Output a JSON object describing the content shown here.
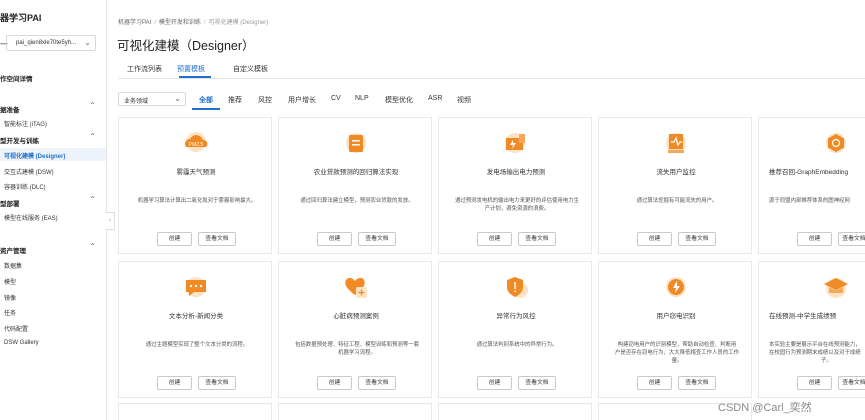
{
  "sidebar": {
    "title": "器学习PAI",
    "workspace_dash": "一",
    "workspace_value": "pai_qien8xle70te5yh...",
    "groups": [
      {
        "label": "作空间详情",
        "caret": ""
      },
      {
        "label": "据准备",
        "caret": "^"
      },
      {
        "label": "型开发与训练",
        "caret": "^"
      },
      {
        "label": "型部署",
        "caret": "^"
      },
      {
        "label": "资产管理",
        "caret": "^"
      }
    ],
    "items": {
      "itag": "智能标注 (iTAG)",
      "designer": "可视化建模 (Designer)",
      "dsw": "交互式建模 (DSW)",
      "dlc": "容器训练 (DLC)",
      "eas": "模型在线服务 (EAS)",
      "dataset": "数据集",
      "model": "模型",
      "image": "镜像",
      "task": "任务",
      "code": "代码配置",
      "gallery": "DSW Gallery"
    }
  },
  "breadcrumb": [
    "机器学习PAI",
    "模型开发和训练",
    "可视化建模 (Designer)"
  ],
  "page_title": "可视化建模（Designer）",
  "tabs": [
    "工作流列表",
    "预置模板",
    "自定义模板"
  ],
  "filter": {
    "value": "业务领域"
  },
  "categories": [
    "全部",
    "推荐",
    "风控",
    "用户增长",
    "CV",
    "NLP",
    "模型优化",
    "ASR",
    "视频"
  ],
  "buttons": {
    "create": "创建",
    "docs": "查看文档"
  },
  "cards": [
    {
      "title": "雾霾天气预测",
      "desc": "机器学习算法计算出二氧化氮对于雾霾影响最大。",
      "icon": "cloud-pm25-icon"
    },
    {
      "title": "农业贷款预测的回归算法实现",
      "desc": "通过回归算法建立模型，预测农业贷款的发放。",
      "icon": "document-list-icon"
    },
    {
      "title": "发电场输出电力预测",
      "desc": "通过预测发电机的输出电力来更好的评估使用电力生产计划，避免资源的浪费。",
      "icon": "power-plant-icon"
    },
    {
      "title": "流失用户监控",
      "desc": "通过算法挖掘有可能流失的用户。",
      "icon": "user-monitor-icon"
    },
    {
      "title": "推荐召回-GraphEmbedding",
      "desc": "源于同盟内部推荐体系的图神经网",
      "icon": "graph-embedding-icon"
    },
    {
      "title": "文本分析-新闻分类",
      "desc": "通过主题模型实现了整个文本分类的流程。",
      "icon": "chat-bubble-icon"
    },
    {
      "title": "心脏病预测案例",
      "desc": "包括数据预处理、特征工程、模型训练和预测等一套机器学习流程。",
      "icon": "heart-plus-icon"
    },
    {
      "title": "异常行为风控",
      "desc": "通过算法判别系统中的异常行为。",
      "icon": "shield-alert-icon"
    },
    {
      "title": "用户窃电识别",
      "desc": "构建窃电用户的识别模型，帮助自动检查、判断用户是否存在窃电行为，大大降低稽查工作人员的工作量。",
      "icon": "electric-meter-icon"
    },
    {
      "title": "在线预测-中学生成绩预",
      "desc": "本实验主要是展示平台在线预测能力，在校园行为预测期末成绩以及对于成绩",
      "icon": "graduation-cap-icon"
    }
  ],
  "card_desc_lines": {
    "c2": [
      "通过预测发电机的输出电力来更好的评估使用电力生",
      "产计划，避免资源的浪费。"
    ],
    "c4": [
      "源于同盟内部推荐体系的图神经网"
    ],
    "c6": [
      "包括数据预处理、特征工程、模型训练和预测等一套",
      "机器学习流程。"
    ],
    "c8": [
      "构建窃电用户的识别模型，帮助自动检查、判断用",
      "户是否存在窃电行为，大大降低稽查工作人员的工作",
      "量。"
    ],
    "c9": [
      "本实验主要是展示平台在线预测能力，",
      "在校园行为预测期末成绩以及对于成绩",
      "子。"
    ]
  },
  "watermark": "CSDN @Carl_奕然",
  "colors": {
    "accent": "#1f6fd0",
    "icon_orange": "#f08a24"
  }
}
